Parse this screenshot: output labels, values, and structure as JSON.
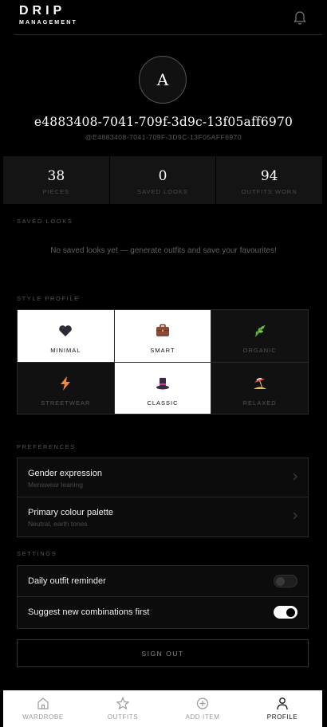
{
  "brand": {
    "title": "DRIP",
    "subtitle": "MANAGEMENT"
  },
  "icons": {
    "notifications": "bell-icon"
  },
  "profile": {
    "avatar_initial": "A",
    "name": "e4883408-7041-709f-3d9c-13f05aff6970",
    "handle": "@E4883408-7041-709F-3D9C-13F05AFF6970"
  },
  "stats": [
    {
      "value": "38",
      "label": "PIECES"
    },
    {
      "value": "0",
      "label": "SAVED LOOKS"
    },
    {
      "value": "94",
      "label": "OUTFITS WORN"
    }
  ],
  "saved_looks": {
    "heading": "SAVED LOOKS",
    "empty_text": "No saved looks yet — generate outfits and save your favourites!"
  },
  "style_profile": {
    "heading": "STYLE PROFILE",
    "options": [
      {
        "label": "MINIMAL",
        "icon": "black-heart-icon",
        "selected": true
      },
      {
        "label": "SMART",
        "icon": "briefcase-icon",
        "selected": true
      },
      {
        "label": "ORGANIC",
        "icon": "herb-icon",
        "selected": false
      },
      {
        "label": "STREETWEAR",
        "icon": "lightning-icon",
        "selected": false
      },
      {
        "label": "CLASSIC",
        "icon": "top-hat-icon",
        "selected": true
      },
      {
        "label": "RELAXED",
        "icon": "beach-umbrella-icon",
        "selected": false
      }
    ]
  },
  "preferences": {
    "heading": "PREFERENCES",
    "items": [
      {
        "title": "Gender expression",
        "value": "Menswear leaning"
      },
      {
        "title": "Primary colour palette",
        "value": "Neutral, earth tones"
      }
    ]
  },
  "settings": {
    "heading": "SETTINGS",
    "items": [
      {
        "label": "Daily outfit reminder",
        "enabled": false
      },
      {
        "label": "Suggest new combinations first",
        "enabled": true
      }
    ]
  },
  "sign_out_label": "SIGN OUT",
  "tabs": [
    {
      "label": "WARDROBE",
      "icon": "home-icon",
      "active": false
    },
    {
      "label": "OUTFITS",
      "icon": "star-icon",
      "active": false
    },
    {
      "label": "ADD ITEM",
      "icon": "plus-circle-icon",
      "active": false
    },
    {
      "label": "PROFILE",
      "icon": "user-icon",
      "active": true
    }
  ],
  "colors": {
    "background": "#000000",
    "panel": "#141414",
    "selected_tile": "#ffffff",
    "muted_text": "#555555"
  }
}
